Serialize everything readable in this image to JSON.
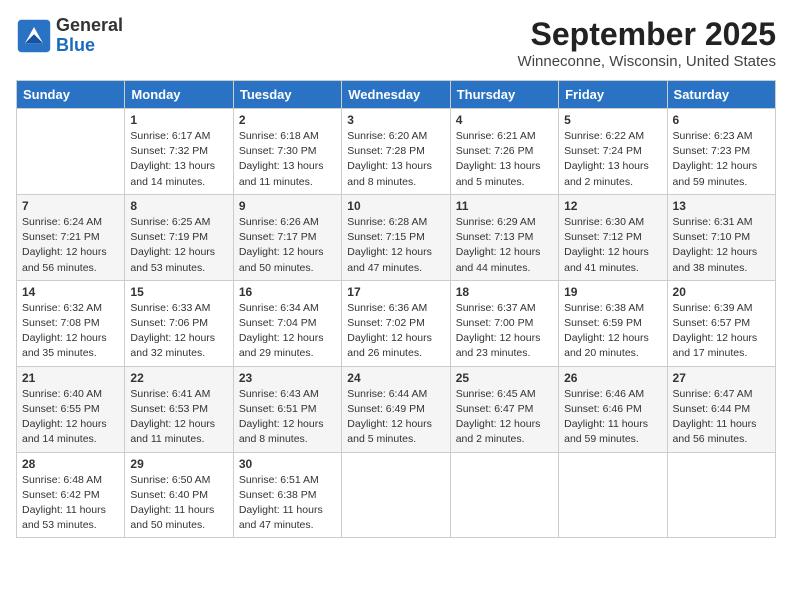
{
  "header": {
    "logo_general": "General",
    "logo_blue": "Blue",
    "month_title": "September 2025",
    "location": "Winneconne, Wisconsin, United States"
  },
  "columns": [
    "Sunday",
    "Monday",
    "Tuesday",
    "Wednesday",
    "Thursday",
    "Friday",
    "Saturday"
  ],
  "weeks": [
    [
      {
        "day": "",
        "info": ""
      },
      {
        "day": "1",
        "info": "Sunrise: 6:17 AM\nSunset: 7:32 PM\nDaylight: 13 hours\nand 14 minutes."
      },
      {
        "day": "2",
        "info": "Sunrise: 6:18 AM\nSunset: 7:30 PM\nDaylight: 13 hours\nand 11 minutes."
      },
      {
        "day": "3",
        "info": "Sunrise: 6:20 AM\nSunset: 7:28 PM\nDaylight: 13 hours\nand 8 minutes."
      },
      {
        "day": "4",
        "info": "Sunrise: 6:21 AM\nSunset: 7:26 PM\nDaylight: 13 hours\nand 5 minutes."
      },
      {
        "day": "5",
        "info": "Sunrise: 6:22 AM\nSunset: 7:24 PM\nDaylight: 13 hours\nand 2 minutes."
      },
      {
        "day": "6",
        "info": "Sunrise: 6:23 AM\nSunset: 7:23 PM\nDaylight: 12 hours\nand 59 minutes."
      }
    ],
    [
      {
        "day": "7",
        "info": "Sunrise: 6:24 AM\nSunset: 7:21 PM\nDaylight: 12 hours\nand 56 minutes."
      },
      {
        "day": "8",
        "info": "Sunrise: 6:25 AM\nSunset: 7:19 PM\nDaylight: 12 hours\nand 53 minutes."
      },
      {
        "day": "9",
        "info": "Sunrise: 6:26 AM\nSunset: 7:17 PM\nDaylight: 12 hours\nand 50 minutes."
      },
      {
        "day": "10",
        "info": "Sunrise: 6:28 AM\nSunset: 7:15 PM\nDaylight: 12 hours\nand 47 minutes."
      },
      {
        "day": "11",
        "info": "Sunrise: 6:29 AM\nSunset: 7:13 PM\nDaylight: 12 hours\nand 44 minutes."
      },
      {
        "day": "12",
        "info": "Sunrise: 6:30 AM\nSunset: 7:12 PM\nDaylight: 12 hours\nand 41 minutes."
      },
      {
        "day": "13",
        "info": "Sunrise: 6:31 AM\nSunset: 7:10 PM\nDaylight: 12 hours\nand 38 minutes."
      }
    ],
    [
      {
        "day": "14",
        "info": "Sunrise: 6:32 AM\nSunset: 7:08 PM\nDaylight: 12 hours\nand 35 minutes."
      },
      {
        "day": "15",
        "info": "Sunrise: 6:33 AM\nSunset: 7:06 PM\nDaylight: 12 hours\nand 32 minutes."
      },
      {
        "day": "16",
        "info": "Sunrise: 6:34 AM\nSunset: 7:04 PM\nDaylight: 12 hours\nand 29 minutes."
      },
      {
        "day": "17",
        "info": "Sunrise: 6:36 AM\nSunset: 7:02 PM\nDaylight: 12 hours\nand 26 minutes."
      },
      {
        "day": "18",
        "info": "Sunrise: 6:37 AM\nSunset: 7:00 PM\nDaylight: 12 hours\nand 23 minutes."
      },
      {
        "day": "19",
        "info": "Sunrise: 6:38 AM\nSunset: 6:59 PM\nDaylight: 12 hours\nand 20 minutes."
      },
      {
        "day": "20",
        "info": "Sunrise: 6:39 AM\nSunset: 6:57 PM\nDaylight: 12 hours\nand 17 minutes."
      }
    ],
    [
      {
        "day": "21",
        "info": "Sunrise: 6:40 AM\nSunset: 6:55 PM\nDaylight: 12 hours\nand 14 minutes."
      },
      {
        "day": "22",
        "info": "Sunrise: 6:41 AM\nSunset: 6:53 PM\nDaylight: 12 hours\nand 11 minutes."
      },
      {
        "day": "23",
        "info": "Sunrise: 6:43 AM\nSunset: 6:51 PM\nDaylight: 12 hours\nand 8 minutes."
      },
      {
        "day": "24",
        "info": "Sunrise: 6:44 AM\nSunset: 6:49 PM\nDaylight: 12 hours\nand 5 minutes."
      },
      {
        "day": "25",
        "info": "Sunrise: 6:45 AM\nSunset: 6:47 PM\nDaylight: 12 hours\nand 2 minutes."
      },
      {
        "day": "26",
        "info": "Sunrise: 6:46 AM\nSunset: 6:46 PM\nDaylight: 11 hours\nand 59 minutes."
      },
      {
        "day": "27",
        "info": "Sunrise: 6:47 AM\nSunset: 6:44 PM\nDaylight: 11 hours\nand 56 minutes."
      }
    ],
    [
      {
        "day": "28",
        "info": "Sunrise: 6:48 AM\nSunset: 6:42 PM\nDaylight: 11 hours\nand 53 minutes."
      },
      {
        "day": "29",
        "info": "Sunrise: 6:50 AM\nSunset: 6:40 PM\nDaylight: 11 hours\nand 50 minutes."
      },
      {
        "day": "30",
        "info": "Sunrise: 6:51 AM\nSunset: 6:38 PM\nDaylight: 11 hours\nand 47 minutes."
      },
      {
        "day": "",
        "info": ""
      },
      {
        "day": "",
        "info": ""
      },
      {
        "day": "",
        "info": ""
      },
      {
        "day": "",
        "info": ""
      }
    ]
  ]
}
